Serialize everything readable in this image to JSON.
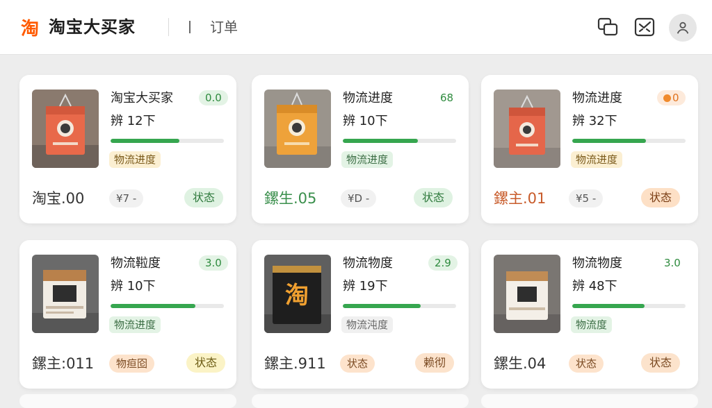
{
  "app": {
    "title": "淘宝大买家",
    "page_label": "订单",
    "logo_icon": "taobao-logo",
    "logo_glyph": "淘"
  },
  "header_icons": [
    "chat-windows-icon",
    "mail-check-icon",
    "user-icon"
  ],
  "cards": [
    {
      "title": "淘宝大买家",
      "count": "辨 12下",
      "badge": "0.0",
      "progress": 0.61,
      "tag": "物流进度",
      "price": "淘宝.00",
      "pill": "¥7 -",
      "status": "状态",
      "thumb": "orange"
    },
    {
      "title": "物流进度",
      "count": "辨 10下",
      "badge": "68",
      "progress": 0.66,
      "tag": "物流进度",
      "price": "鏍生.05",
      "pill": "¥D -",
      "status": "状态",
      "thumb": "amber"
    },
    {
      "title": "物流进度",
      "count": "辨 32下",
      "badge": "0",
      "progress": 0.65,
      "tag": "物流进度",
      "price": "鏍主.01",
      "pill": "¥5 -",
      "status": "状态",
      "thumb": "orange"
    },
    {
      "title": "物流鞡度",
      "count": "辨 10下",
      "badge": "3.0",
      "progress": 0.75,
      "tag": "物流进度",
      "price": "鏍主:011",
      "pill": "物疸囵",
      "status": "状态",
      "thumb": "white"
    },
    {
      "title": "物流物度",
      "count": "辨 19下",
      "badge": "2.9",
      "progress": 0.69,
      "tag": "物流沌度",
      "price": "鏍主.911",
      "pill": "状态",
      "status": "赖彻",
      "thumb": "black"
    },
    {
      "title": "物流物度",
      "count": "辨 48下",
      "badge": "3.0",
      "progress": 0.64,
      "tag": "物流度",
      "price": "鏍生.04",
      "pill": "状态",
      "status": "状态",
      "thumb": "white"
    }
  ],
  "thumb_glyph": "淘",
  "colors": {
    "accent_orange": "#ff5a00",
    "progress_green": "#36a64f",
    "background": "#ededed"
  }
}
